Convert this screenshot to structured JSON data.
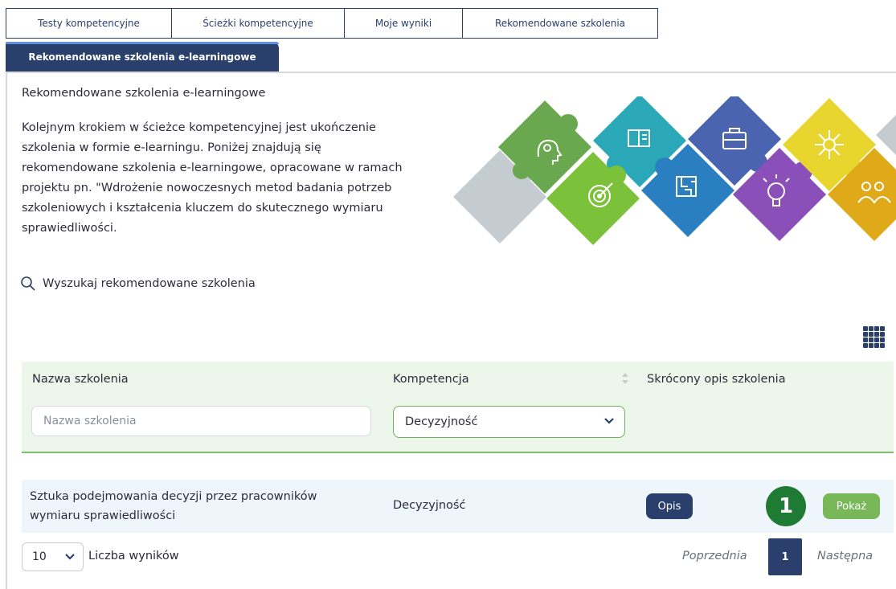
{
  "tabs": [
    {
      "label": "Testy kompetencyjne"
    },
    {
      "label": "Ścieżki kompetencyjne"
    },
    {
      "label": "Moje wyniki"
    },
    {
      "label": "Rekomendowane szkolenia"
    }
  ],
  "active_tab": {
    "label": "Rekomendowane szkolenia e-learningowe"
  },
  "section": {
    "title": "Rekomendowane szkolenia e-learningowe",
    "intro": "Kolejnym krokiem w ścieżce kompetencyjnej jest ukończenie szkolenia w formie e-learningu. Poniżej znajdują się rekomendowane szkolenia e-learningowe, opracowane w ramach projektu pn. \"Wdrożenie nowoczesnych metod badania potrzeb szkoleniowych i kształcenia kluczem do skutecznego wymiaru sprawiedliwości."
  },
  "search": {
    "label": "Wyszukaj rekomendowane szkolenia",
    "icon": "search-icon"
  },
  "table": {
    "columns": {
      "name": "Nazwa szkolenia",
      "competence": "Kompetencja",
      "description": "Skrócony opis szkolenia"
    },
    "filters": {
      "name_placeholder": "Nazwa szkolenia",
      "competence_selected": "Decyzyjność"
    },
    "rows": [
      {
        "name": "Sztuka podejmowania decyzji przez pracowników wymiaru sprawiedliwości",
        "competence": "Decyzyjność",
        "opis_label": "Opis",
        "badge": "1",
        "show_label": "Pokaż"
      }
    ]
  },
  "footer": {
    "page_size": "10",
    "results_label": "Liczba wyników",
    "prev_label": "Poprzednia",
    "current_page": "1",
    "next_label": "Następna"
  },
  "colors": {
    "primary": "#2a3f6b",
    "accent_green": "#78b858",
    "badge_green": "#1f7a33",
    "filter_bg": "#ecf6ea",
    "row_bg": "#eef5fb"
  },
  "puzzle_icons": [
    "head-icon",
    "book-icon",
    "briefcase-icon",
    "network-icon",
    "target-icon",
    "maze-icon",
    "lightbulb-icon",
    "people-icon"
  ]
}
